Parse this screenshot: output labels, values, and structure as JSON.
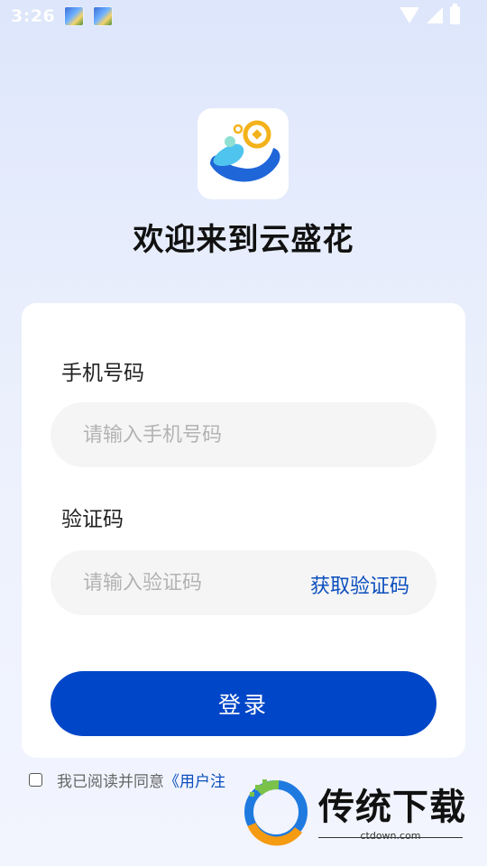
{
  "status_bar": {
    "time": "3:26"
  },
  "app": {
    "title": "欢迎来到云盛花"
  },
  "form": {
    "phone_label": "手机号码",
    "phone_placeholder": "请输入手机号码",
    "code_label": "验证码",
    "code_placeholder": "请输入验证码",
    "get_code_label": "获取验证码",
    "login_label": "登录"
  },
  "agreement": {
    "text": "我已阅读并同意",
    "link": "《用户注",
    "checked": false
  },
  "watermark": {
    "title": "传统下载",
    "url": "ctdown.com"
  },
  "colors": {
    "primary": "#0046c8",
    "link": "#0b4ebd",
    "logo_blue": "#2d7be8",
    "logo_gold": "#f3b21b"
  },
  "icons": [
    "wifi-icon",
    "signal-icon",
    "battery-icon",
    "app-logo"
  ]
}
